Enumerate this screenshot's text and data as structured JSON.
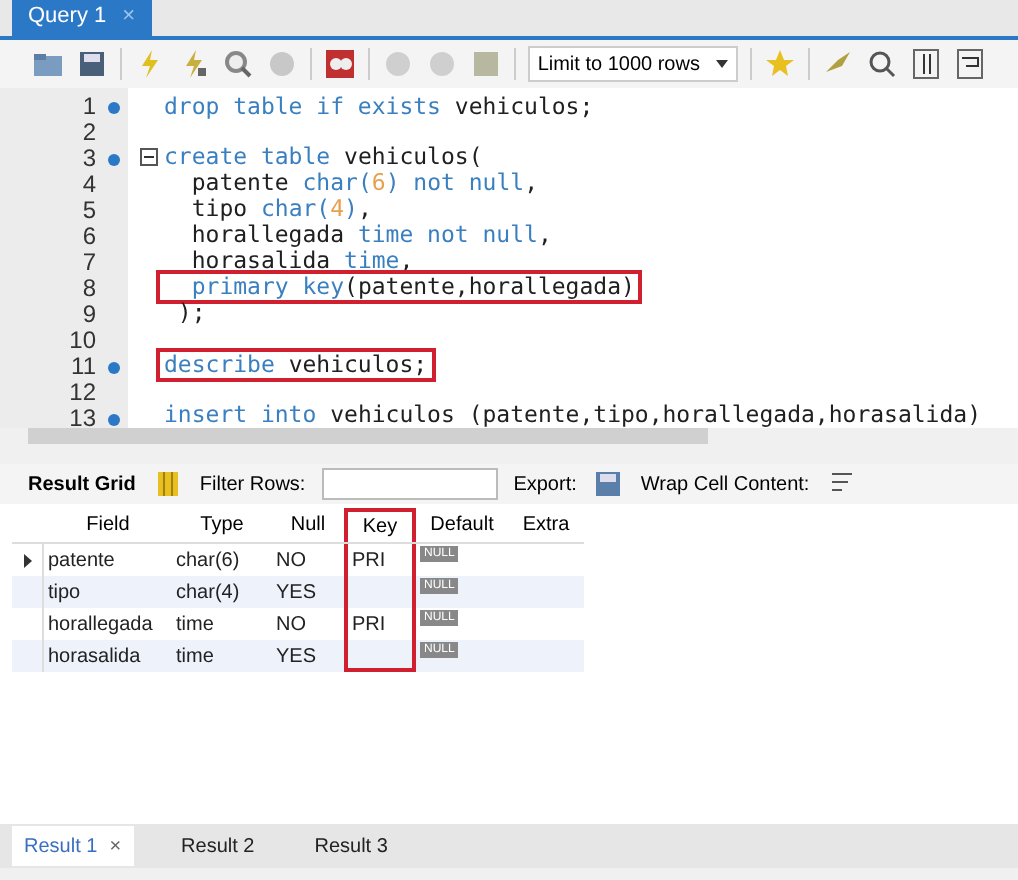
{
  "editor_tabs": [
    {
      "label": "Query 1",
      "selected": true,
      "close": "×"
    }
  ],
  "toolbar": {
    "limit": "Limit to 1000 rows"
  },
  "code_lines": [
    {
      "number": "1",
      "marker": true,
      "fold": false,
      "highlighted": false,
      "tokens": [
        {
          "text": "drop table if exists",
          "kind": "keyword"
        },
        {
          "text": " vehiculos;",
          "kind": "plain"
        }
      ]
    },
    {
      "number": "2",
      "marker": false,
      "fold": false,
      "highlighted": false
    },
    {
      "number": "3",
      "marker": true,
      "fold": true,
      "highlighted": false,
      "tokens": [
        {
          "text": "create table",
          "kind": "keyword"
        },
        {
          "text": " vehiculos(",
          "kind": "plain"
        }
      ]
    },
    {
      "number": "4",
      "marker": false,
      "fold": false,
      "highlighted": false,
      "tokens": [
        {
          "text": "  patente ",
          "kind": "plain"
        },
        {
          "text": "char(",
          "kind": "keyword"
        },
        {
          "text": "6",
          "kind": "number"
        },
        {
          "text": ")",
          "kind": "keyword"
        },
        {
          "text": " not null",
          "kind": "keyword"
        },
        {
          "text": ",",
          "kind": "plain"
        }
      ]
    },
    {
      "number": "5",
      "marker": false,
      "fold": false,
      "highlighted": false,
      "tokens": [
        {
          "text": "  tipo ",
          "kind": "plain"
        },
        {
          "text": "char(",
          "kind": "keyword"
        },
        {
          "text": "4",
          "kind": "number"
        },
        {
          "text": ")",
          "kind": "keyword"
        },
        {
          "text": ",",
          "kind": "plain"
        }
      ]
    },
    {
      "number": "6",
      "marker": false,
      "fold": false,
      "highlighted": false,
      "tokens": [
        {
          "text": "  horallegada ",
          "kind": "plain"
        },
        {
          "text": "time not null",
          "kind": "keyword"
        },
        {
          "text": ",",
          "kind": "plain"
        }
      ]
    },
    {
      "number": "7",
      "marker": false,
      "fold": false,
      "highlighted": false,
      "tokens": [
        {
          "text": "  horasalida ",
          "kind": "plain"
        },
        {
          "text": "time",
          "kind": "keyword"
        },
        {
          "text": ",",
          "kind": "plain"
        }
      ]
    },
    {
      "number": "8",
      "marker": false,
      "fold": false,
      "highlighted": true,
      "tokens": [
        {
          "text": "  primary key",
          "kind": "keyword"
        },
        {
          "text": "(patente,horallegada)",
          "kind": "plain"
        }
      ]
    },
    {
      "number": "9",
      "marker": false,
      "fold": false,
      "highlighted": false,
      "tokens": [
        {
          "text": " );",
          "kind": "plain"
        }
      ]
    },
    {
      "number": "10",
      "marker": false,
      "fold": false,
      "highlighted": false
    },
    {
      "number": "11",
      "marker": true,
      "fold": false,
      "highlighted": true,
      "tokens": [
        {
          "text": "describe",
          "kind": "keyword"
        },
        {
          "text": " vehiculos;",
          "kind": "plain"
        }
      ]
    },
    {
      "number": "12",
      "marker": false,
      "fold": false,
      "highlighted": false
    },
    {
      "number": "13",
      "marker": true,
      "fold": false,
      "highlighted": false,
      "tokens": [
        {
          "text": "insert into",
          "kind": "keyword"
        },
        {
          "text": " vehiculos (patente,tipo,horallegada,horasalida)",
          "kind": "plain"
        }
      ]
    }
  ],
  "result_toolbar": {
    "result_grid": "Result Grid",
    "filter_label": "Filter Rows:",
    "export_label": "Export:",
    "wrap_label": "Wrap Cell Content:"
  },
  "table": {
    "columns": [
      {
        "label": "Field",
        "highlighted": false
      },
      {
        "label": "Type",
        "highlighted": false
      },
      {
        "label": "Null",
        "highlighted": false
      },
      {
        "label": "Key",
        "highlighted": true
      },
      {
        "label": "Default",
        "highlighted": false
      },
      {
        "label": "Extra",
        "highlighted": false
      }
    ],
    "rows": [
      {
        "selected": true,
        "cells": [
          "patente",
          "char(6)",
          "NO",
          "PRI",
          "NULL",
          ""
        ]
      },
      {
        "selected": false,
        "cells": [
          "tipo",
          "char(4)",
          "YES",
          "",
          "NULL",
          ""
        ]
      },
      {
        "selected": false,
        "cells": [
          "horallegada",
          "time",
          "NO",
          "PRI",
          "NULL",
          ""
        ]
      },
      {
        "selected": false,
        "cells": [
          "horasalida",
          "time",
          "YES",
          "",
          "NULL",
          ""
        ]
      }
    ]
  },
  "result_tabs": [
    {
      "label": "Result 1",
      "selected": true,
      "close": "×"
    },
    {
      "label": "Result 2",
      "selected": false
    },
    {
      "label": "Result 3",
      "selected": false
    }
  ]
}
